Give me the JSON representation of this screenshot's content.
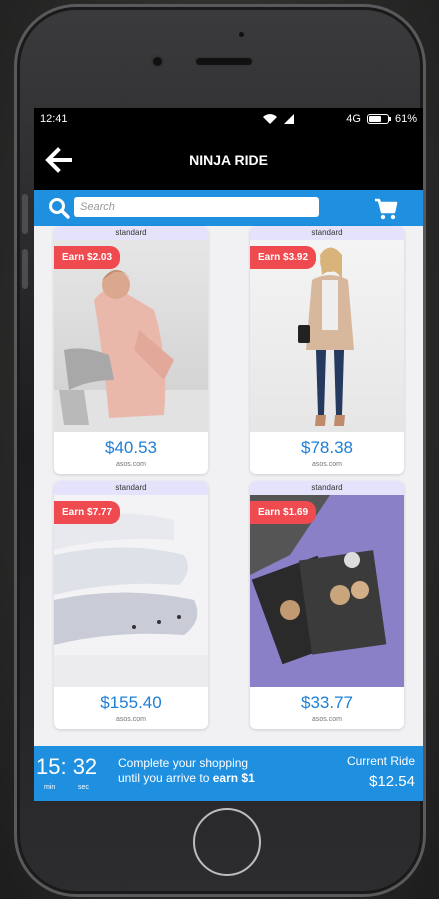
{
  "status": {
    "time": "12:41",
    "network": "4G",
    "battery": "61%"
  },
  "appbar": {
    "title": "NINJA RIDE"
  },
  "search": {
    "placeholder": "Search"
  },
  "products": [
    {
      "tag": "standard",
      "earn": "Earn $2.03",
      "price": "$40.53",
      "store": "asos.com",
      "image": "woman-pink-jacket"
    },
    {
      "tag": "standard",
      "earn": "Earn $3.92",
      "price": "$78.38",
      "store": "asos.com",
      "image": "woman-beige-coat"
    },
    {
      "tag": "standard",
      "earn": "Earn $7.77",
      "price": "$155.40",
      "store": "asos.com",
      "image": "grey-cushions"
    },
    {
      "tag": "standard",
      "earn": "Earn $1.69",
      "price": "$33.77",
      "store": "asos.com",
      "image": "photo-prints-purple"
    }
  ],
  "bottom": {
    "timer": "15: 32",
    "min_label": "min",
    "sec_label": "sec",
    "message_line1": "Complete your shopping",
    "message_line2_prefix": "until you arrive to ",
    "message_line2_bold": "earn $1",
    "ride_label": "Current Ride",
    "ride_value": "$12.54"
  },
  "colors": {
    "accent": "#1f8fe0",
    "earn_badge": "#ee4a4f",
    "price": "#1d7fd6",
    "tag_bg": "#e5e3fb"
  }
}
